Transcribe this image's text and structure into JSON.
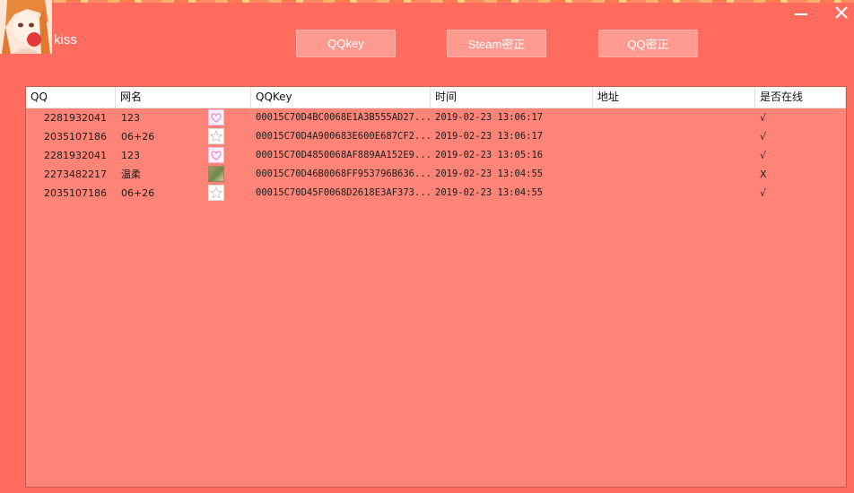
{
  "window": {
    "title": "kiss",
    "minimize_icon": "minimize-icon",
    "close_icon": "close-icon"
  },
  "toolbar": {
    "qqkey_label": "QQkey",
    "steam_label": "Steam密正",
    "qqmz_label": "QQ密正"
  },
  "table": {
    "columns": [
      "QQ",
      "网名",
      "QQKey",
      "时间",
      "地址",
      "是否在线"
    ],
    "rows": [
      {
        "qq": "2281932041",
        "nick": "123",
        "avatar": "pink-flower-avatar",
        "key": "00015C70D4BC0068E1A3B555AD27...",
        "time": "2019-02-23 13:06:17",
        "addr": "",
        "online": "√"
      },
      {
        "qq": "2035107186",
        "nick": "06+26",
        "avatar": "star-avatar",
        "key": "00015C70D4A900683E600E687CF2...",
        "time": "2019-02-23 13:06:17",
        "addr": "",
        "online": "√"
      },
      {
        "qq": "2281932041",
        "nick": "123",
        "avatar": "pink-flower-avatar",
        "key": "00015C70D4850068AF889AA152E9...",
        "time": "2019-02-23 13:05:16",
        "addr": "",
        "online": "√"
      },
      {
        "qq": "2273482217",
        "nick": "温柔",
        "avatar": "photo-avatar",
        "key": "00015C70D46B0068FF953796B636...",
        "time": "2019-02-23 13:04:55",
        "addr": "",
        "online": "X"
      },
      {
        "qq": "2035107186",
        "nick": "06+26",
        "avatar": "star-avatar",
        "key": "00015C70D45F0068D2618E3AF373...",
        "time": "2019-02-23 13:04:55",
        "addr": "",
        "online": "√"
      }
    ]
  },
  "colors": {
    "window_bg": "#ff6b5c",
    "list_bg": "#ff8478",
    "button_bg": "#ff9a90",
    "header_bg": "#ffffff"
  }
}
